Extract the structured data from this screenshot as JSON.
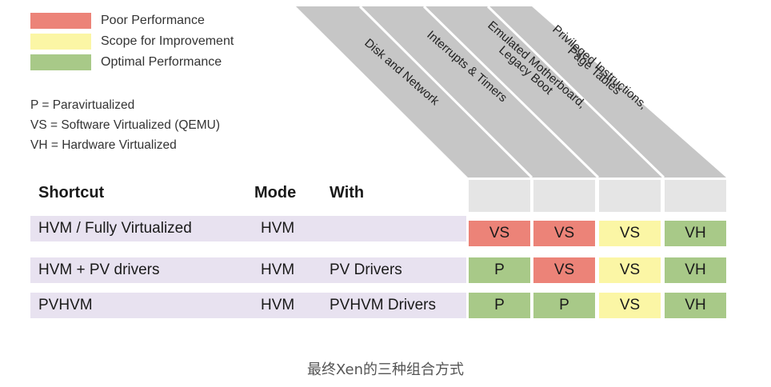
{
  "legend": [
    {
      "label": "Poor Performance",
      "color": "#ec8378"
    },
    {
      "label": "Scope for Improvement",
      "color": "#fbf6a5"
    },
    {
      "label": "Optimal Performance",
      "color": "#a8c988"
    }
  ],
  "abbreviations": [
    "P = Paravirtualized",
    "VS = Software Virtualized (QEMU)",
    "VH = Hardware Virtualized"
  ],
  "columns": {
    "shortcut": "Shortcut",
    "mode": "Mode",
    "with": "With",
    "perf": [
      {
        "line1": "Disk and Network",
        "line2": ""
      },
      {
        "line1": "Interrupts & Timers",
        "line2": ""
      },
      {
        "line1": "Emulated Motherboard,",
        "line2": "Legacy Boot"
      },
      {
        "line1": "Privileged Instructions,",
        "line2": "Page Tables"
      }
    ]
  },
  "rows": [
    {
      "shortcut": "HVM / Fully Virtualized",
      "mode": "HVM",
      "with": "",
      "cells": [
        {
          "value": "VS",
          "status": "poor"
        },
        {
          "value": "VS",
          "status": "poor"
        },
        {
          "value": "VS",
          "status": "improve"
        },
        {
          "value": "VH",
          "status": "optimal"
        }
      ]
    },
    {
      "shortcut": "HVM + PV drivers",
      "mode": "HVM",
      "with": "PV Drivers",
      "cells": [
        {
          "value": "P",
          "status": "optimal"
        },
        {
          "value": "VS",
          "status": "poor"
        },
        {
          "value": "VS",
          "status": "improve"
        },
        {
          "value": "VH",
          "status": "optimal"
        }
      ]
    },
    {
      "shortcut": "PVHVM",
      "mode": "HVM",
      "with": "PVHVM Drivers",
      "cells": [
        {
          "value": "P",
          "status": "optimal"
        },
        {
          "value": "P",
          "status": "optimal"
        },
        {
          "value": "VS",
          "status": "improve"
        },
        {
          "value": "VH",
          "status": "optimal"
        }
      ]
    }
  ],
  "status_colors": {
    "poor": "#ec8378",
    "improve": "#fbf6a5",
    "optimal": "#a8c988"
  },
  "caption": "最终Xen的三种组合方式"
}
